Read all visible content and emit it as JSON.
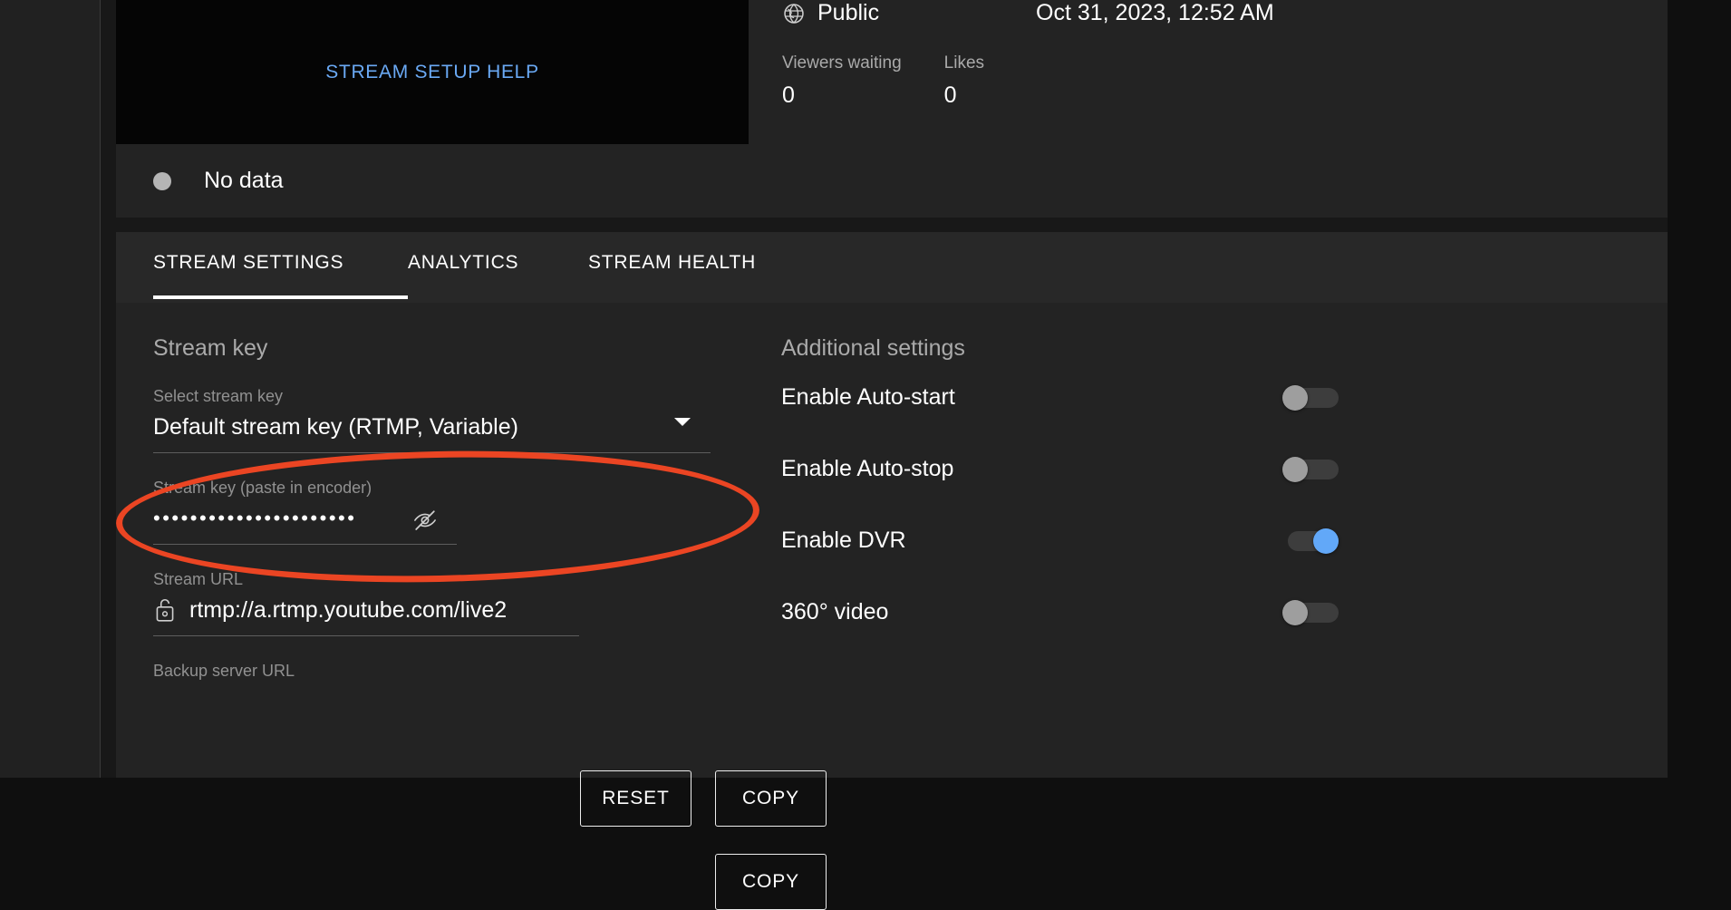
{
  "preview": {
    "setup_help_label": "STREAM SETUP HELP"
  },
  "meta": {
    "globe_icon": "globe-icon",
    "visibility": "Public",
    "datetime": "Oct 31, 2023, 12:52 AM",
    "stats": [
      {
        "label": "Viewers waiting",
        "value": "0"
      },
      {
        "label": "Likes",
        "value": "0"
      }
    ]
  },
  "status": {
    "indicator_icon": "status-dot-icon",
    "text": "No data"
  },
  "tabs": [
    {
      "label": "STREAM SETTINGS",
      "active": true
    },
    {
      "label": "ANALYTICS",
      "active": false
    },
    {
      "label": "STREAM HEALTH",
      "active": false
    }
  ],
  "stream_key_section": {
    "title": "Stream key",
    "select_stream_key": {
      "label": "Select stream key",
      "value": "Default stream key (RTMP, Variable)",
      "caret_icon": "chevron-down-icon"
    },
    "stream_key": {
      "label": "Stream key (paste in encoder)",
      "value": "••••••••••••••••••••••",
      "visibility_icon": "eye-off-icon",
      "reset_label": "RESET",
      "copy_label": "COPY"
    },
    "stream_url": {
      "label": "Stream URL",
      "lock_icon": "unlock-icon",
      "value": "rtmp://a.rtmp.youtube.com/live2",
      "copy_label": "COPY"
    },
    "backup_url": {
      "label": "Backup server URL"
    }
  },
  "additional_settings": {
    "title": "Additional settings",
    "items": [
      {
        "label": "Enable Auto-start",
        "on": false
      },
      {
        "label": "Enable Auto-stop",
        "on": false
      },
      {
        "label": "Enable DVR",
        "on": true
      },
      {
        "label": "360° video",
        "on": false
      }
    ]
  },
  "annotation": {
    "shape": "ellipse-highlight",
    "color": "#eb4523"
  },
  "colors": {
    "accent_link": "#6aa9f4",
    "toggle_on": "#62a8f8",
    "panel_bg": "#232323",
    "card_bg": "#282828",
    "annotation": "#eb4523"
  }
}
